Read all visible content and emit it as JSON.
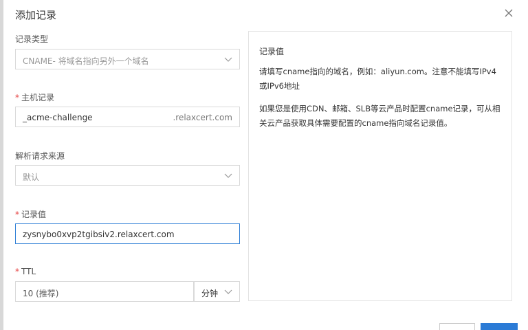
{
  "dialog": {
    "title": "添加记录"
  },
  "record_type": {
    "label": "记录类型",
    "value": "CNAME- 将域名指向另外一个域名"
  },
  "host_record": {
    "label": "主机记录",
    "value": "_acme-challenge",
    "suffix": ".relaxcert.com"
  },
  "resolve_source": {
    "label": "解析请求来源",
    "value": "默认"
  },
  "record_value": {
    "label": "记录值",
    "value": "zysnybo0xvp2tgibsiv2.relaxcert.com"
  },
  "ttl": {
    "label": "TTL",
    "value": "10 (推荐)",
    "unit": "分钟"
  },
  "help": {
    "title": "记录值",
    "paragraph1": "请填写cname指向的域名，例如：aliyun.com。注意不能填写IPv4或IPv6地址",
    "paragraph2": "如果您是使用CDN、邮箱、SLB等云产品时配置cname记录，可从相关云产品获取具体需要配置的cname指向域名记录值。"
  },
  "colors": {
    "accent": "#2b7bd6",
    "required": "#e64545"
  }
}
